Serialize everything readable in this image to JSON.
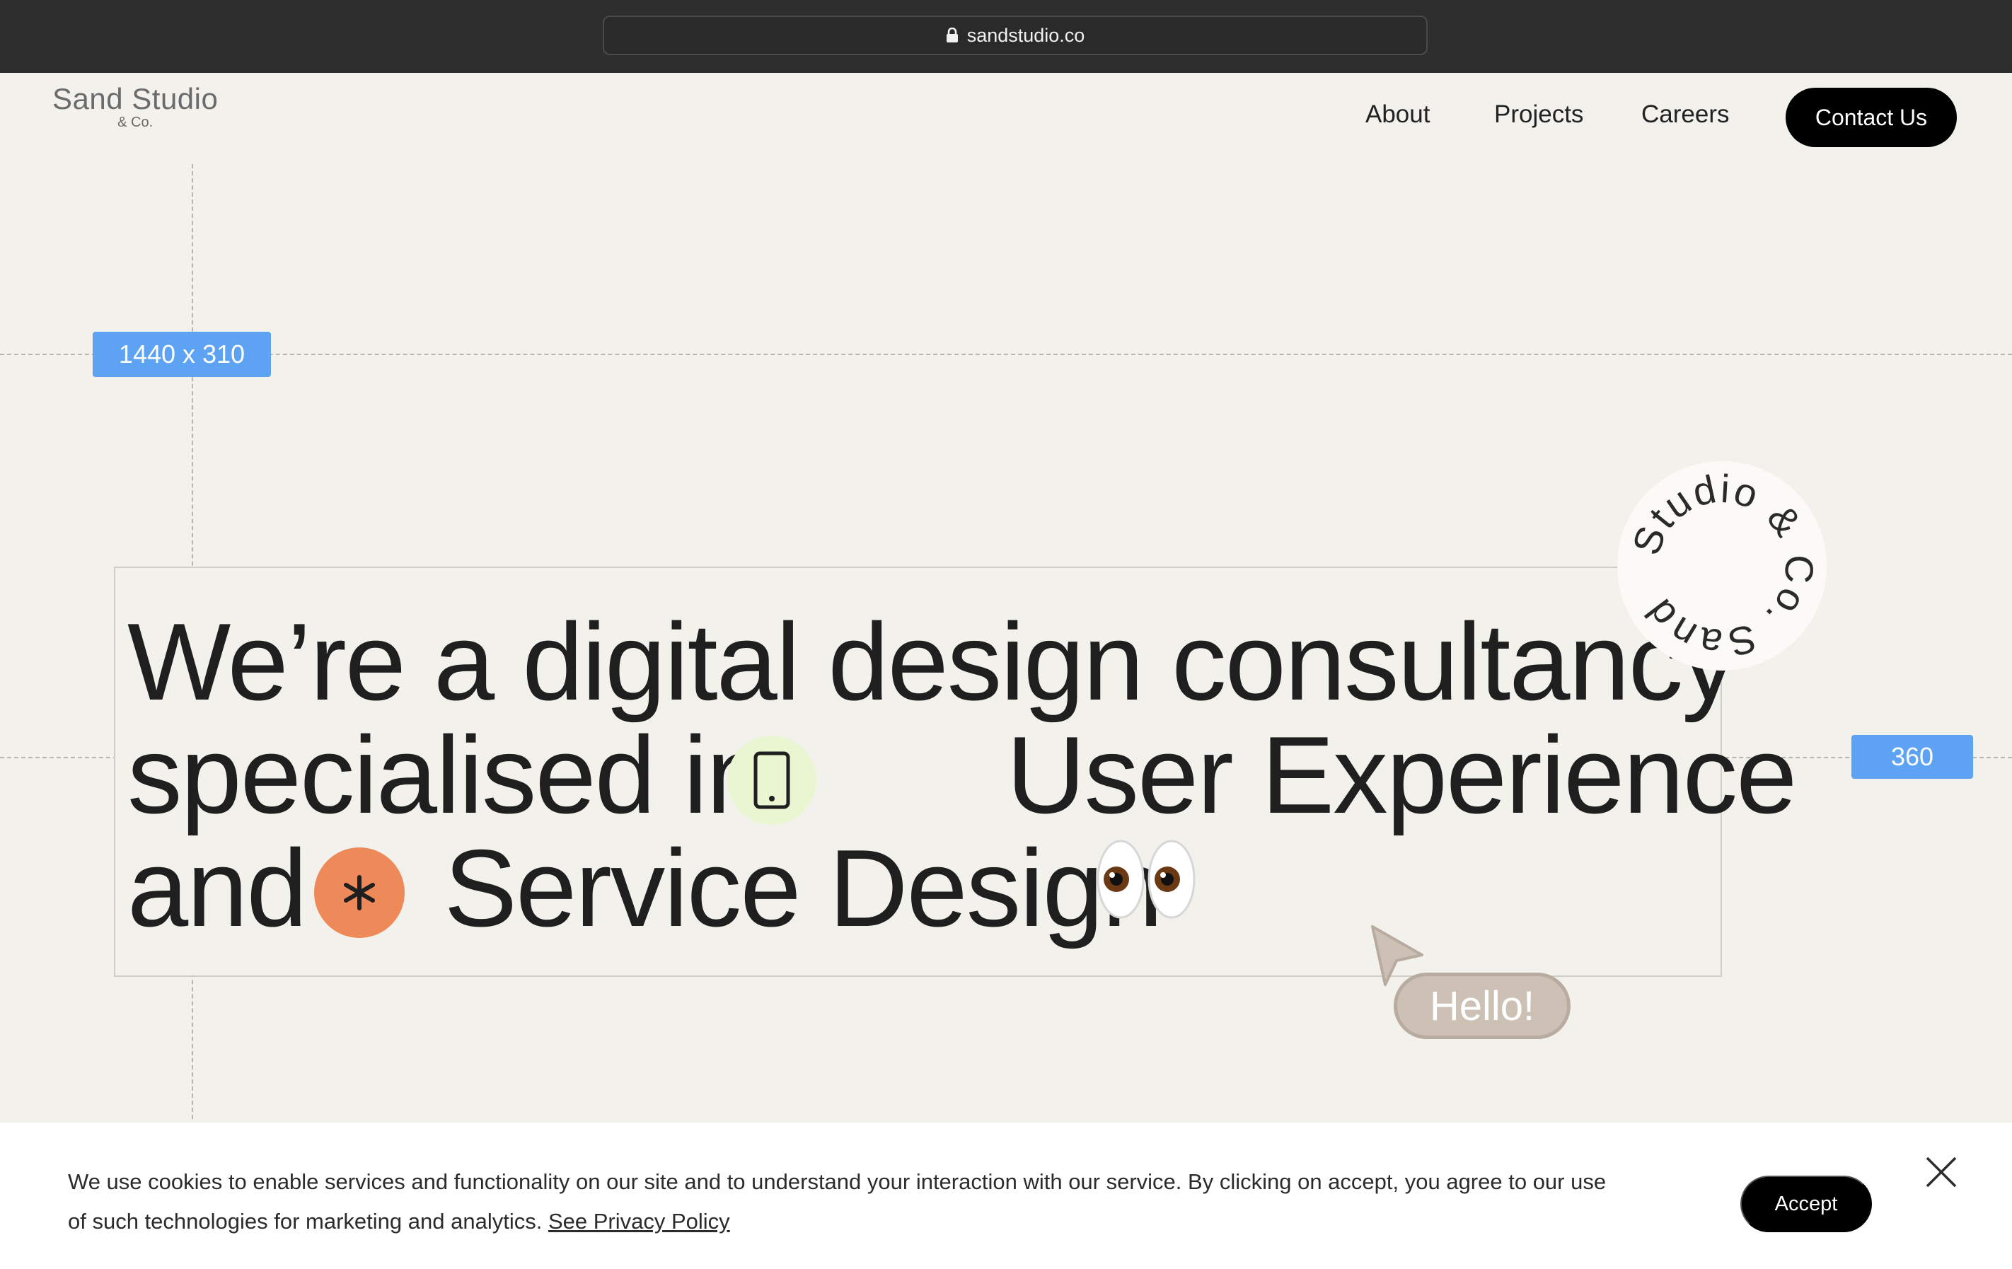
{
  "browser": {
    "url": "sandstudio.co",
    "lock_icon": "lock-icon"
  },
  "header": {
    "logo_main": "Sand Studio",
    "logo_sub": "& Co.",
    "nav": [
      {
        "label": "About"
      },
      {
        "label": "Projects"
      },
      {
        "label": "Careers"
      }
    ],
    "contact_label": "Contact Us"
  },
  "guides": {
    "dim_width_label": "1440 x 310",
    "dim_height_label": "360"
  },
  "hero": {
    "line1": "We’re a digital design consultancy",
    "line2_prefix": "specialised in",
    "line2_highlight": "User Experience",
    "line3_prefix": "and",
    "line3_highlight": "Service Design",
    "phone_icon": "phone-icon",
    "asterisk_icon": "asterisk-icon",
    "eyes_icon": "eyes-emoji",
    "colors": {
      "phone_bg": "#eaf6d2",
      "asterisk_bg": "#ee8a5a",
      "badge_blue": "#5ea3f3"
    }
  },
  "badge": {
    "circular_text": "Studio & Co. Sand"
  },
  "cursor": {
    "hello_label": "Hello!",
    "pointer_icon": "cursor-pointer-icon"
  },
  "cookie": {
    "text_part1": "We use cookies  to enable services and functionality on our site and to understand your interaction with our service. By clicking on accept, you agree to our use of such technologies for marketing and analytics.",
    "policy_link": "See Privacy Policy",
    "accept_label": "Accept",
    "close_icon": "close-icon"
  }
}
